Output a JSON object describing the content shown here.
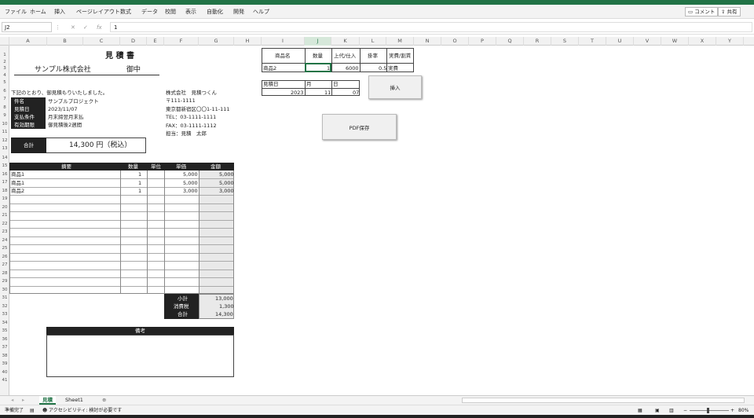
{
  "ribbon": {
    "menus": [
      "ファイル",
      "ホーム",
      "挿入",
      "ページレイアウト",
      "数式",
      "データ",
      "校閲",
      "表示",
      "自動化",
      "開発",
      "ヘルプ"
    ],
    "comment_label": "コメント",
    "share_label": "共有"
  },
  "formula": {
    "name_box": "J2",
    "content": "1"
  },
  "columns": [
    "A",
    "B",
    "C",
    "D",
    "E",
    "F",
    "G",
    "H",
    "I",
    "J",
    "K",
    "L",
    "M",
    "N",
    "O",
    "P",
    "Q",
    "R",
    "S",
    "T",
    "U",
    "V",
    "W",
    "X",
    "Y"
  ],
  "rows": [
    "1",
    "2",
    "3",
    "4",
    "5",
    "6",
    "7",
    "8",
    "9",
    "10",
    "11",
    "12",
    "13",
    "14",
    "15",
    "16",
    "17",
    "18",
    "19",
    "20",
    "21",
    "22",
    "23",
    "24",
    "25",
    "26",
    "27",
    "28",
    "29",
    "30",
    "31",
    "32",
    "33",
    "34",
    "35",
    "36",
    "37",
    "38",
    "39",
    "40",
    "41"
  ],
  "quote": {
    "title": "見 積 書",
    "client": "サンプル株式会社",
    "honorific": "御中",
    "intro": "下記のとおり、御見積もりいたしました。",
    "info_labels": [
      "件名",
      "見積日",
      "支払条件",
      "有効期限"
    ],
    "info_values": [
      "サンプルプロジェクト",
      "2023/11/07",
      "月末締翌月末払",
      "御見積後2週間"
    ],
    "company": [
      "株式会社　見積つくん",
      "〒111-1111",
      "東京都新宿区〇〇1-11-111",
      "TEL：03-1111-1111",
      "FAX：03-1111-1112",
      "担当：見積　太郎"
    ],
    "total_label": "合計",
    "total_value": "14,300 円（税込）",
    "table_headers": [
      "摘要",
      "数量",
      "単位",
      "単価",
      "金額"
    ],
    "items": [
      {
        "name": "商品1",
        "qty": "1",
        "unit": "",
        "price": "5,000",
        "amount": "5,000"
      },
      {
        "name": "商品1",
        "qty": "1",
        "unit": "",
        "price": "5,000",
        "amount": "5,000"
      },
      {
        "name": "商品2",
        "qty": "1",
        "unit": "",
        "price": "3,000",
        "amount": "3,000"
      }
    ],
    "summary": [
      {
        "label": "小計",
        "value": "13,000"
      },
      {
        "label": "消費税",
        "value": "1,300"
      },
      {
        "label": "合計",
        "value": "14,300"
      }
    ],
    "remarks_label": "備考"
  },
  "input_table": {
    "headers": [
      "商品名",
      "数量",
      "上代/仕入",
      "掛率",
      "実費/割賃"
    ],
    "values": [
      "商品2",
      "1",
      "6000",
      "0.5",
      "実費"
    ]
  },
  "date_table": {
    "headers": [
      "見積日",
      "月",
      "日"
    ],
    "values": [
      "2023",
      "11",
      "07"
    ]
  },
  "buttons": {
    "insert": "挿入",
    "pdf": "PDF保存"
  },
  "sheets": [
    "見積",
    "Sheet1"
  ],
  "status": {
    "ready": "準備完了",
    "accessibility": "アクセシビリティ: 検討が必要です",
    "zoom": "80%"
  }
}
